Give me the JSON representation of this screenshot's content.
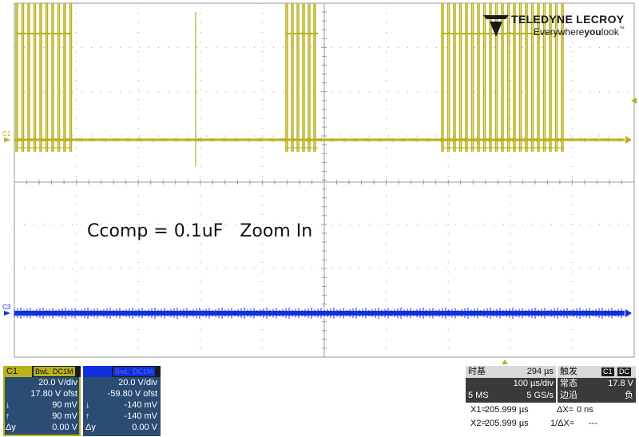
{
  "annotation": "Ccomp = 0.1uF   Zoom In",
  "logo": {
    "brand": "TELEDYNE LECROY",
    "tag_a": "Everywhere",
    "tag_b": "you",
    "tag_c": "look",
    "tm": "™"
  },
  "markers": {
    "c1": "C1",
    "c3": "C3"
  },
  "colors": {
    "c1": "#b8b11e",
    "c3": "#1030e0",
    "grid": "#9a9a9a"
  },
  "channels": [
    {
      "name": "C1",
      "bwl": "BwL",
      "coupling": "DC1M",
      "vdiv": "20.0 V/div",
      "offset": "17.80 V ofst",
      "down_label": "↓",
      "down": "90 mV",
      "up_label": "↑",
      "up": "90 mV",
      "dy_label": "Δy",
      "dy": "0.00 V",
      "active": true
    },
    {
      "name": "C3",
      "bwl": "BwL",
      "coupling": "DC1M",
      "vdiv": "20.0 V/div",
      "offset": "-59.80 V ofst",
      "down_label": "↓",
      "down": "-140 mV",
      "up_label": "↑",
      "up": "-140 mV",
      "dy_label": "Δy",
      "dy": "0.00 V",
      "active": false
    }
  ],
  "timebase": {
    "label": "时基",
    "delay": "294 µs",
    "tdiv": "100 µs/div",
    "memory": "5 MS",
    "rate": "5 GS/s"
  },
  "trigger": {
    "label": "触发",
    "source": "C1",
    "coupling": "DC",
    "mode": "常态",
    "level": "17.8 V",
    "type": "边沿",
    "slope": "负"
  },
  "cursors": {
    "x1_label": "X1=",
    "x1": "205.999 µs",
    "dx_label": "ΔX=",
    "dx": "0 ns",
    "x2_label": "X2=",
    "x2": "205.999 µs",
    "inv_label": "1/ΔX=",
    "inv": "---"
  }
}
